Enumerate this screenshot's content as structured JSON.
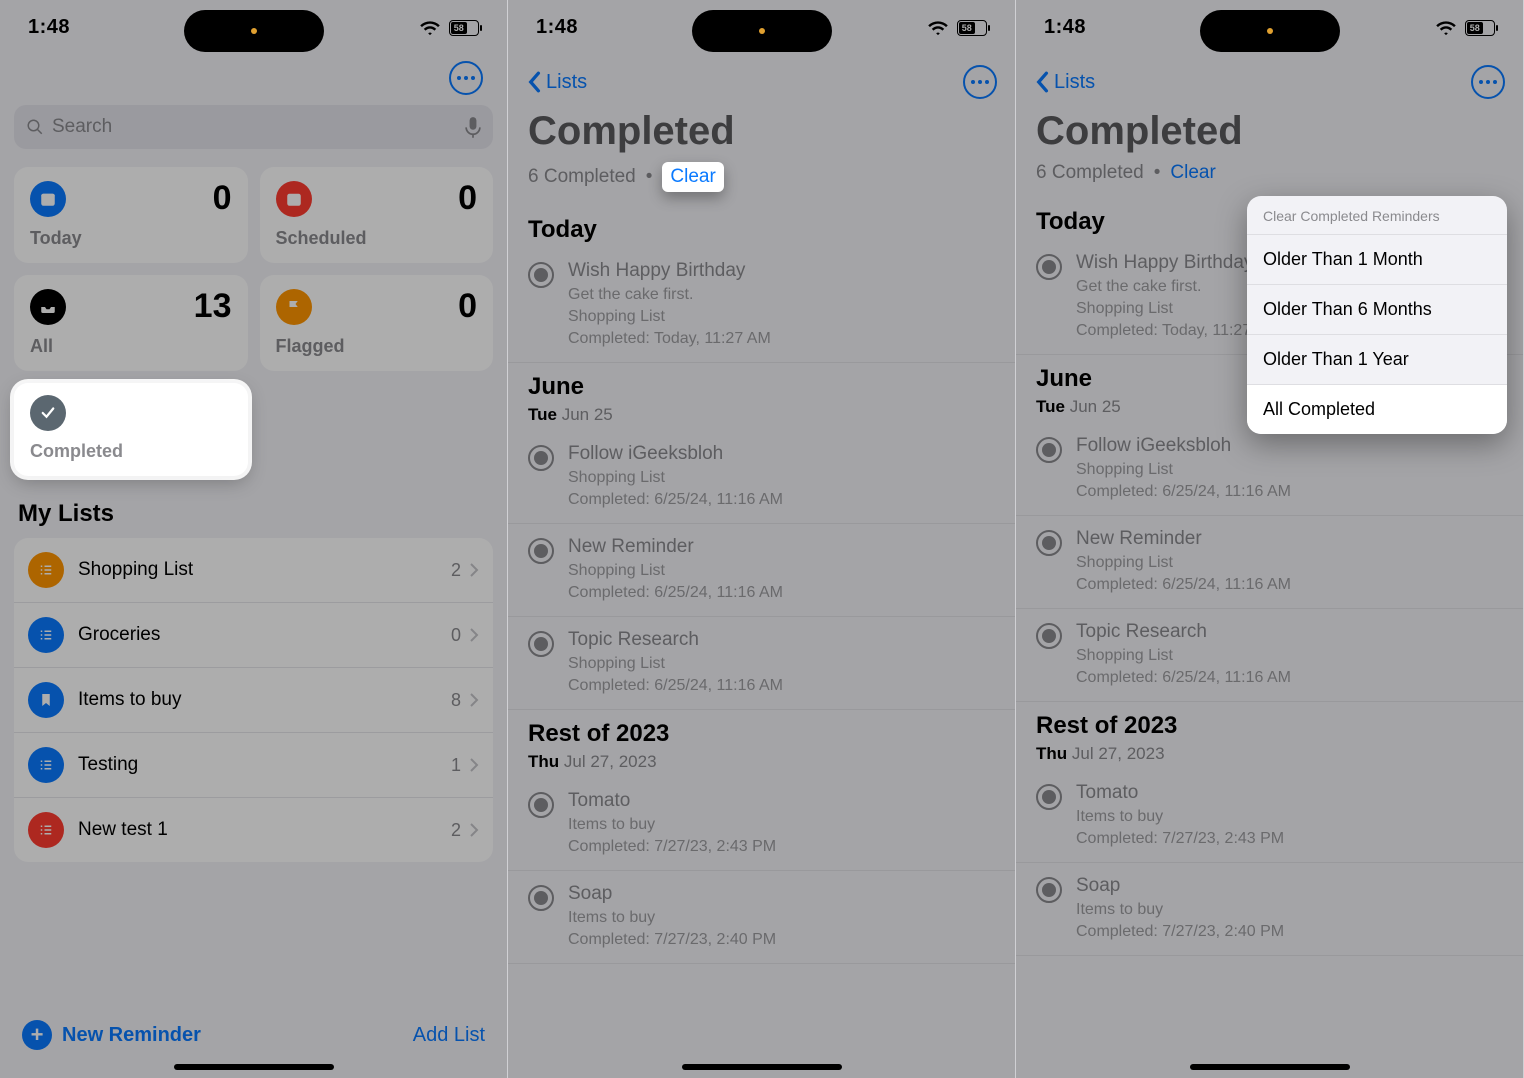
{
  "status": {
    "time": "1:48",
    "battery_text": "58"
  },
  "screen1": {
    "search_placeholder": "Search",
    "tiles": {
      "today": {
        "label": "Today",
        "count": "0"
      },
      "scheduled": {
        "label": "Scheduled",
        "count": "0"
      },
      "all": {
        "label": "All",
        "count": "13"
      },
      "flagged": {
        "label": "Flagged",
        "count": "0"
      },
      "completed": {
        "label": "Completed"
      }
    },
    "mylists_header": "My Lists",
    "lists": [
      {
        "name": "Shopping List",
        "count": "2",
        "color": "#ff9500"
      },
      {
        "name": "Groceries",
        "count": "0",
        "color": "#0a7aff"
      },
      {
        "name": "Items to buy",
        "count": "8",
        "color": "#0a7aff"
      },
      {
        "name": "Testing",
        "count": "1",
        "color": "#0a7aff"
      },
      {
        "name": "New test 1",
        "count": "2",
        "color": "#ff3b30"
      }
    ],
    "new_reminder": "New Reminder",
    "add_list": "Add List"
  },
  "completed_view": {
    "back_label": "Lists",
    "title": "Completed",
    "count_text": "6 Completed",
    "clear_label": "Clear",
    "sections": [
      {
        "header": "Today",
        "items": [
          {
            "title": "Wish Happy Birthday",
            "note": "Get the cake first.",
            "list": "Shopping List",
            "completed": "Completed: Today, 11:27 AM"
          }
        ]
      },
      {
        "header": "June",
        "sub_bold": "Tue",
        "sub_rest": "Jun 25",
        "items": [
          {
            "title": "Follow iGeeksbloh",
            "list": "Shopping List",
            "completed": "Completed: 6/25/24, 11:16 AM"
          },
          {
            "title": "New Reminder",
            "list": "Shopping List",
            "completed": "Completed: 6/25/24, 11:16 AM"
          },
          {
            "title": "Topic Research",
            "list": "Shopping List",
            "completed": "Completed: 6/25/24, 11:16 AM"
          }
        ]
      },
      {
        "header": "Rest of 2023",
        "sub_bold": "Thu",
        "sub_rest": "Jul 27, 2023",
        "items": [
          {
            "title": "Tomato",
            "list": "Items to buy",
            "completed": "Completed: 7/27/23, 2:43 PM"
          },
          {
            "title": "Soap",
            "list": "Items to buy",
            "completed": "Completed: 7/27/23, 2:40 PM"
          }
        ]
      }
    ]
  },
  "clear_menu": {
    "header": "Clear Completed Reminders",
    "options": [
      "Older Than 1 Month",
      "Older Than 6 Months",
      "Older Than 1 Year",
      "All Completed"
    ],
    "selected_index": 3
  }
}
